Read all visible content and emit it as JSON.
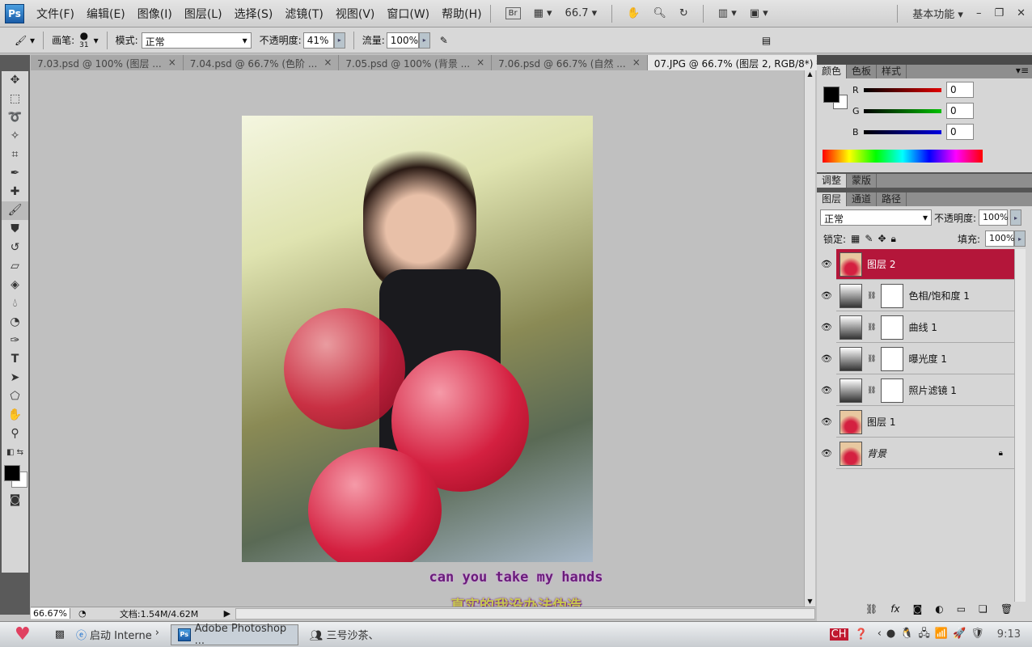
{
  "menubar": {
    "logo": "Ps",
    "items": [
      "文件(F)",
      "编辑(E)",
      "图像(I)",
      "图层(L)",
      "选择(S)",
      "滤镜(T)",
      "视图(V)",
      "窗口(W)",
      "帮助(H)"
    ],
    "bridge": "Br",
    "zoom": "66.7",
    "workspace": "基本功能"
  },
  "options": {
    "brush_label": "画笔:",
    "brush_size": "31",
    "mode_label": "模式:",
    "mode_value": "正常",
    "opacity_label": "不透明度:",
    "opacity_value": "41%",
    "flow_label": "流量:",
    "flow_value": "100%"
  },
  "tabs": [
    "7.03.psd @ 100% (图层 ...",
    "7.04.psd @ 66.7% (色阶 ...",
    "7.05.psd @ 100% (背景 ...",
    "7.06.psd @ 66.7% (自然 ...",
    "07.JPG @ 66.7% (图层 2, RGB/8*) *"
  ],
  "canvas": {
    "subtitle_en": "can you take my hands",
    "subtitle_cn": "真实的我没办法伪造"
  },
  "status": {
    "zoom": "66.67%",
    "doc": "文档:1.54M/4.62M"
  },
  "color_panel": {
    "tabs": [
      "颜色",
      "色板",
      "样式"
    ],
    "channels": [
      {
        "label": "R",
        "value": "0",
        "color": "#e00000"
      },
      {
        "label": "G",
        "value": "0",
        "color": "#00c000"
      },
      {
        "label": "B",
        "value": "0",
        "color": "#0000e0"
      }
    ]
  },
  "adjust_panel": {
    "tabs": [
      "调整",
      "蒙版"
    ]
  },
  "layers_panel": {
    "tabs": [
      "图层",
      "通道",
      "路径"
    ],
    "blend": "正常",
    "opacity_label": "不透明度:",
    "opacity": "100%",
    "lock_label": "锁定:",
    "fill_label": "填充:",
    "fill": "100%",
    "layers": [
      {
        "name": "图层 2",
        "selected": true
      },
      {
        "name": "色相/饱和度 1"
      },
      {
        "name": "曲线 1"
      },
      {
        "name": "曝光度 1"
      },
      {
        "name": "照片滤镜 1"
      },
      {
        "name": "图层 1"
      },
      {
        "name": "背景",
        "locked": true
      }
    ]
  },
  "taskbar": {
    "ie": "启动 Interne",
    "photoshop": "Adobe Photoshop ...",
    "qq": "三号沙茶、",
    "lang": "CH",
    "time": "9:13"
  },
  "colors": {
    "selected_layer": "#b4163a"
  }
}
